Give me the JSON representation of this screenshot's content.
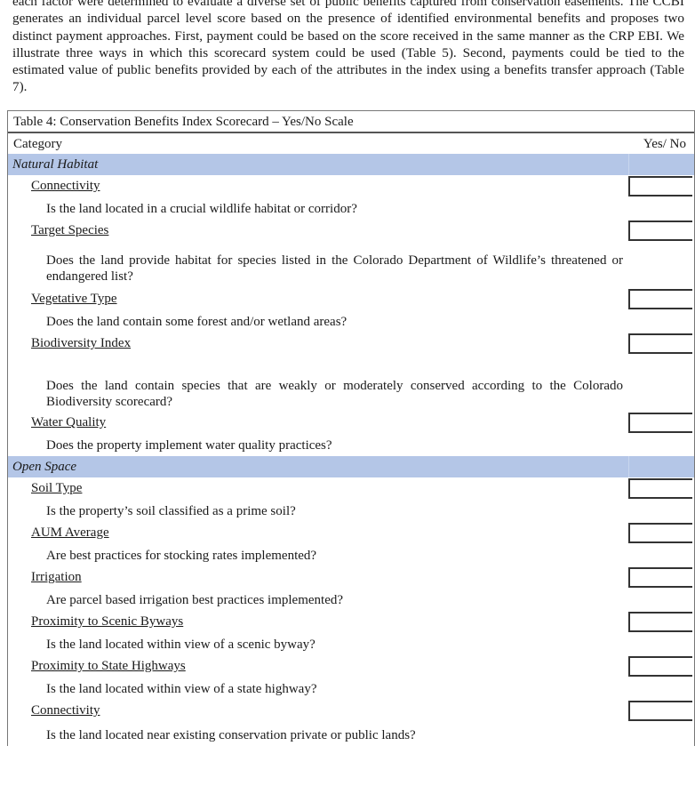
{
  "intro_paragraph": "each factor were determined to evaluate a diverse set of public benefits captured from conservation easements. The CCBI generates an individual parcel level score based on the presence of identified environmental benefits and proposes two distinct payment approaches. First, payment could be based on the score received in the same manner as the CRP EBI. We illustrate three ways in which this scorecard system could be used (Table 5). Second, payments could be tied to the estimated value of public benefits provided by each of the attributes in the index using a benefits transfer approach (Table 7).",
  "table": {
    "caption": "Table 4: Conservation Benefits Index Scorecard – Yes/No Scale",
    "header": {
      "category": "Category",
      "answer": "Yes/ No"
    },
    "colors": {
      "section_band": "#b4c6e7"
    },
    "sections": [
      {
        "name": "Natural Habitat",
        "items": [
          {
            "label": "Connectivity",
            "question": "Is the land located in a crucial wildlife habitat or corridor?",
            "answer": ""
          },
          {
            "label": "Target Species",
            "question": "Does the land provide habitat for species listed in the Colorado Department of Wildlife’s threatened or endangered list?",
            "answer": ""
          },
          {
            "label": "Vegetative Type",
            "question": "Does the land contain some forest and/or wetland areas?",
            "answer": ""
          },
          {
            "label": "Biodiversity Index",
            "question": "Does the land contain species that are weakly or moderately conserved according to the Colorado Biodiversity scorecard?",
            "answer": ""
          },
          {
            "label": "Water Quality",
            "question": "Does the property implement water quality practices?",
            "answer": ""
          }
        ]
      },
      {
        "name": "Open Space",
        "items": [
          {
            "label": "Soil Type",
            "question": "Is the property’s soil classified as a prime soil?",
            "answer": ""
          },
          {
            "label": "AUM Average",
            "question": "Are best practices for stocking rates implemented?",
            "answer": ""
          },
          {
            "label": "Irrigation",
            "question": "Are parcel based irrigation best practices implemented?",
            "answer": ""
          },
          {
            "label": "Proximity to Scenic Byways",
            "question": "Is the land located within view of a scenic byway?",
            "answer": ""
          },
          {
            "label": "Proximity to State Highways",
            "question": "Is the land located within view of a state highway?",
            "answer": ""
          },
          {
            "label": "Connectivity",
            "question": "Is the land located near existing conservation private or public lands?",
            "answer": ""
          }
        ]
      }
    ]
  }
}
